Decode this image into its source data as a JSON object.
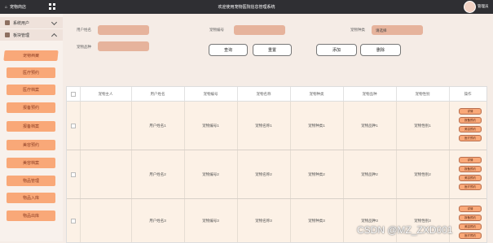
{
  "header": {
    "brand": "宠物商店",
    "title": "欢迎使用宠物医院信息管理系统",
    "user": "管理员"
  },
  "sidebar": {
    "groups": [
      {
        "label": "系统用户"
      },
      {
        "label": "板块管理"
      }
    ],
    "items": [
      {
        "label": "宠物档案",
        "active": true
      },
      {
        "label": "医疗预约"
      },
      {
        "label": "医疗档案"
      },
      {
        "label": "报备预约"
      },
      {
        "label": "报备档案"
      },
      {
        "label": "美容预约"
      },
      {
        "label": "美容档案"
      },
      {
        "label": "物品管理"
      },
      {
        "label": "物品入库"
      },
      {
        "label": "物品出库"
      }
    ]
  },
  "search": {
    "fields": [
      {
        "label": "用户姓名",
        "value": ""
      },
      {
        "label": "宠物编号",
        "value": ""
      },
      {
        "label": "宠物种类",
        "value": "请选择"
      },
      {
        "label": "宠物品种",
        "value": ""
      }
    ],
    "buttons": {
      "query": "查询",
      "reset": "重置",
      "add": "添加",
      "delete": "删除"
    }
  },
  "table": {
    "columns": [
      "宠物主人",
      "用户姓名",
      "宠物编号",
      "宠物名称",
      "宠物种类",
      "宠物品种",
      "宠物性别",
      "操作"
    ],
    "rows": [
      {
        "user": "用户姓名1",
        "code": "宠物编号1",
        "name": "宠物名称1",
        "kind": "宠物种类1",
        "breed": "宠物品种1",
        "sex": "宠物性别1"
      },
      {
        "user": "用户姓名2",
        "code": "宠物编号2",
        "name": "宠物名称2",
        "kind": "宠物种类2",
        "breed": "宠物品种2",
        "sex": "宠物性别2"
      },
      {
        "user": "用户姓名3",
        "code": "宠物编号3",
        "name": "宠物名称3",
        "kind": "宠物种类3",
        "breed": "宠物品种3",
        "sex": "宠物性别3"
      }
    ],
    "actions": [
      "详情",
      "报备预约",
      "美容预约",
      "医疗预约"
    ]
  },
  "watermark": "CSDN @MZ_ZXD001"
}
